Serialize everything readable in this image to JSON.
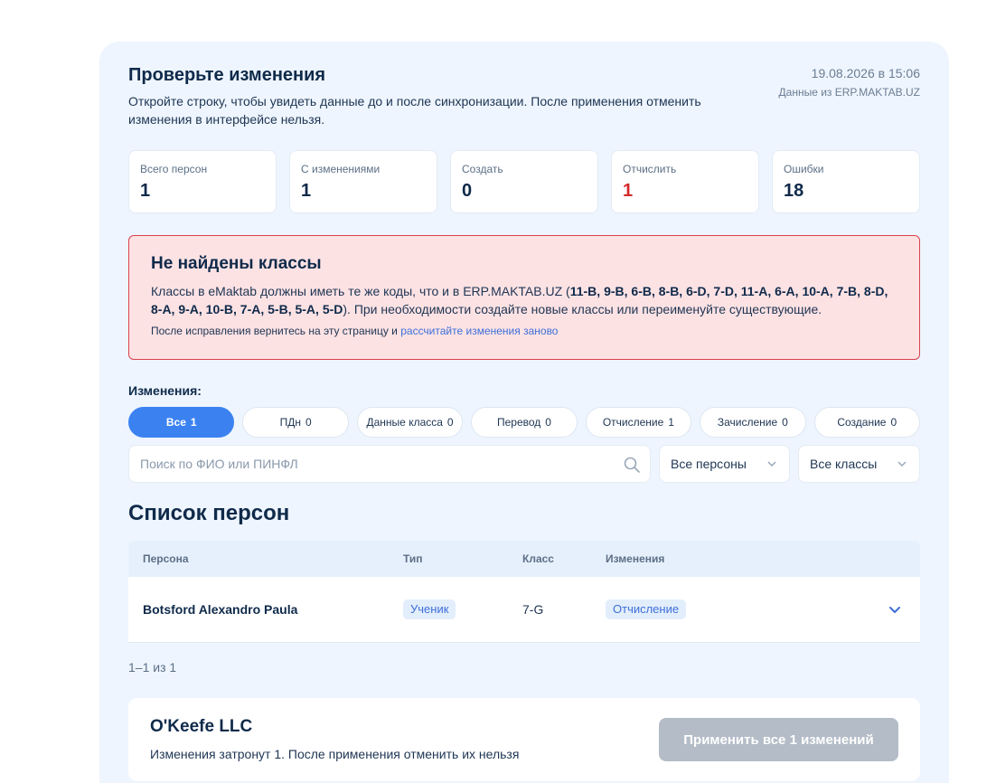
{
  "header": {
    "title": "Проверьте изменения",
    "subtitle": "Откройте строку, чтобы увидеть данные до и после синхронизации. После применения отменить изменения в интерфейсе нельзя.",
    "date": "19.08.2026 в 15:06",
    "source": "Данные из ERP.MAKTAB.UZ"
  },
  "stats": [
    {
      "label": "Всего персон",
      "value": "1"
    },
    {
      "label": "С изменениями",
      "value": "1"
    },
    {
      "label": "Создать",
      "value": "0"
    },
    {
      "label": "Отчислить",
      "value": "1"
    },
    {
      "label": "Ошибки",
      "value": "18"
    }
  ],
  "alert": {
    "title": "Не найдены классы",
    "text_before": "Классы в eMaktab должны иметь те же коды, что и в ERP.MAKTAB.UZ (",
    "classes": "11-B, 9-B, 6-B, 8-B, 6-D, 7-D, 11-A, 6-A, 10-A, 7-B, 8-D, 8-A, 9-A, 10-B, 7-A, 5-B, 5-A, 5-D",
    "text_after": "). При необходимости создайте новые классы или переименуйте существующие.",
    "foot_text": "После исправления вернитесь на эту страницу и ",
    "foot_link": "рассчитайте изменения заново"
  },
  "changes_label": "Изменения:",
  "filters": [
    {
      "label": "Все",
      "count": "1"
    },
    {
      "label": "ПДн",
      "count": "0"
    },
    {
      "label": "Данные класса",
      "count": "0"
    },
    {
      "label": "Перевод",
      "count": "0"
    },
    {
      "label": "Отчисление",
      "count": "1"
    },
    {
      "label": "Зачисление",
      "count": "0"
    },
    {
      "label": "Создание",
      "count": "0"
    }
  ],
  "search": {
    "placeholder": "Поиск по ФИО или ПИНФЛ"
  },
  "person_select": "Все персоны",
  "class_select": "Все классы",
  "list_title": "Список персон",
  "table": {
    "headers": {
      "person": "Персона",
      "type": "Тип",
      "class": "Класс",
      "changes": "Изменения"
    },
    "rows": [
      {
        "person": "Botsford Alexandro Paula",
        "type": "Ученик",
        "class": "7-G",
        "change": "Отчисление"
      }
    ]
  },
  "pager": "1–1 из 1",
  "footer": {
    "org": "O'Keefe LLC",
    "note": "Изменения затронут 1. После применения отменить их нельзя",
    "apply_label": "Применить все 1 изменений"
  },
  "colors": {
    "accent": "#3b82f0",
    "error": "#d42a2a",
    "panel": "#eef5fe",
    "alert_bg": "#fde2e4"
  }
}
